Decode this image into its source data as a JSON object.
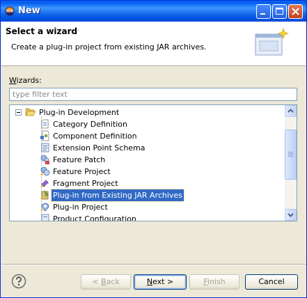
{
  "window": {
    "title": "New",
    "colors": {
      "titlebar": "#0a5fe8",
      "selection": "#316ac5",
      "face": "#ece9d8"
    }
  },
  "header": {
    "title": "Select a wizard",
    "description": "Create a plug-in project from existing JAR archives.",
    "banner_icon": "wizard-banner-icon"
  },
  "filter": {
    "label_prefix": "W",
    "label_rest": "izards:",
    "placeholder": "type filter text",
    "value": ""
  },
  "tree": {
    "root": {
      "label": "Plug-in Development",
      "icon": "folder-open-icon",
      "expanded": true
    },
    "items": [
      {
        "label": "Category Definition",
        "icon": "category-icon",
        "selected": false
      },
      {
        "label": "Component Definition",
        "icon": "component-icon",
        "selected": false
      },
      {
        "label": "Extension Point Schema",
        "icon": "schema-icon",
        "selected": false
      },
      {
        "label": "Feature Patch",
        "icon": "feature-patch-icon",
        "selected": false
      },
      {
        "label": "Feature Project",
        "icon": "feature-project-icon",
        "selected": false
      },
      {
        "label": "Fragment Project",
        "icon": "fragment-icon",
        "selected": false
      },
      {
        "label": "Plug-in from Existing JAR Archives",
        "icon": "plugin-jar-icon",
        "selected": true
      },
      {
        "label": "Plug-in Project",
        "icon": "plugin-project-icon",
        "selected": false
      },
      {
        "label": "Product Configuration",
        "icon": "product-config-icon",
        "selected": false
      }
    ]
  },
  "buttons": {
    "back_prefix": "< ",
    "back_key": "B",
    "back_rest": "ack",
    "next_key": "N",
    "next_rest": "ext >",
    "finish_key": "F",
    "finish_rest": "inish",
    "cancel": "Cancel"
  }
}
